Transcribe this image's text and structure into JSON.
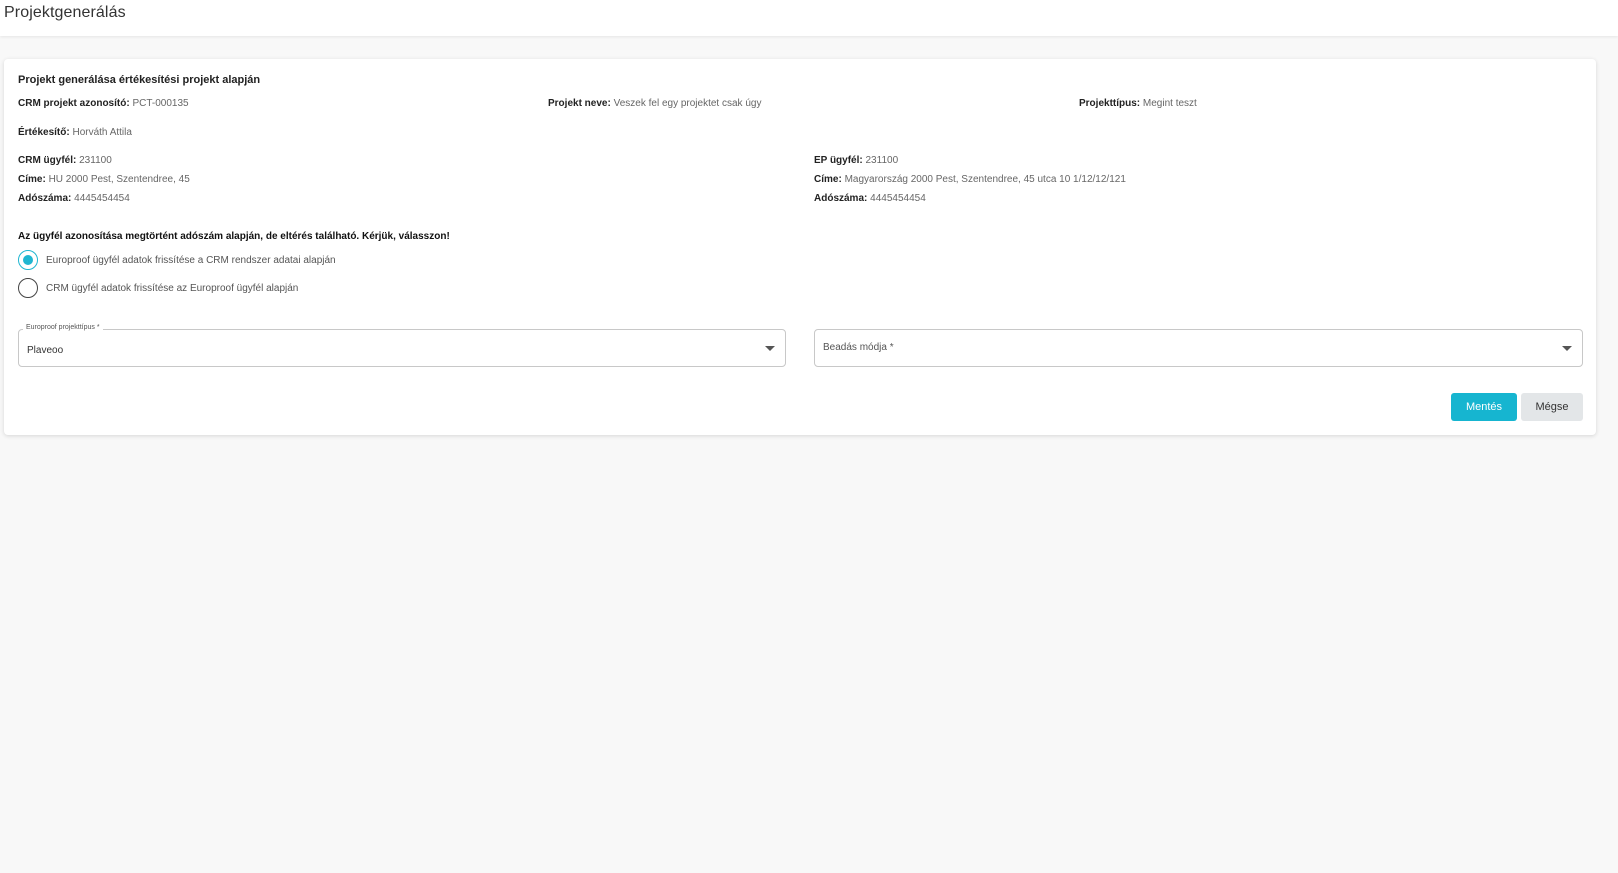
{
  "page": {
    "title": "Projektgenerálás"
  },
  "card": {
    "title": "Projekt generálása értékesítési projekt alapján",
    "crm_project_id": {
      "label": "CRM projekt azonosító:",
      "value": "PCT-000135"
    },
    "project_name": {
      "label": "Projekt neve:",
      "value": "Veszek fel egy projektet csak úgy"
    },
    "project_type": {
      "label": "Projekttípus:",
      "value": "Megint teszt"
    },
    "salesperson": {
      "label": "Értékesítő:",
      "value": "Horváth Attila"
    },
    "crm_customer": {
      "id": {
        "label": "CRM ügyfél:",
        "value": "231100"
      },
      "address": {
        "label": "Címe:",
        "value": "HU 2000 Pest, Szentendree, 45"
      },
      "tax": {
        "label": "Adószáma:",
        "value": "4445454454"
      }
    },
    "ep_customer": {
      "id": {
        "label": "EP ügyfél:",
        "value": "231100"
      },
      "address": {
        "label": "Címe:",
        "value": "Magyarország 2000 Pest, Szentendree, 45 utca 10 1/12/12/121"
      },
      "tax": {
        "label": "Adószáma:",
        "value": "4445454454"
      }
    },
    "warning": "Az ügyfél azonosítása megtörtént adószám alapján, de eltérés található. Kérjük, válasszon!",
    "options": [
      {
        "label": "Europroof ügyfél adatok frissítése a CRM rendszer adatai alapján",
        "checked": true
      },
      {
        "label": "CRM ügyfél adatok frissítése az Europroof ügyfél alapján",
        "checked": false
      }
    ],
    "europroof_type": {
      "label": "Europroof projekttípus *",
      "value": "Plaveoo"
    },
    "submission_mode": {
      "placeholder": "Beadás módja *"
    },
    "buttons": {
      "save": "Mentés",
      "cancel": "Mégse"
    }
  },
  "colors": {
    "accent": "#16b5d0",
    "background": "#f8f8f8"
  }
}
